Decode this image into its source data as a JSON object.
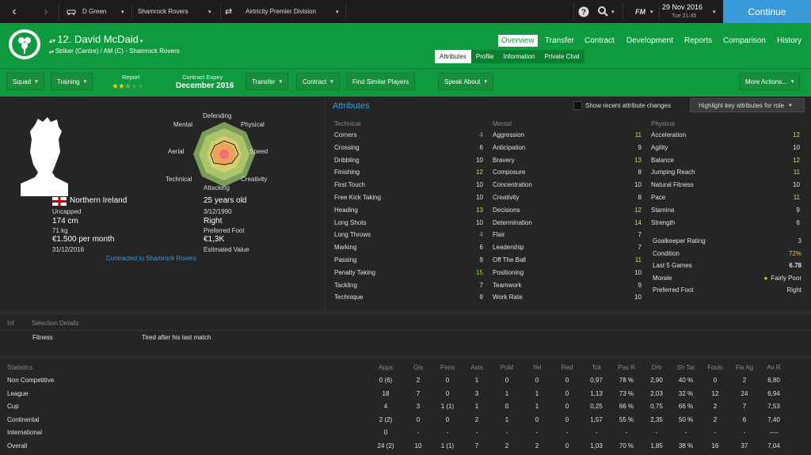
{
  "topbar": {
    "manager": "D Green",
    "club": "Shamrock Rovers",
    "competition": "Airtricity Premier Division",
    "date": "29 Nov 2016",
    "time": "Tue 21:45",
    "fm_label": "FM",
    "continue": "Continue"
  },
  "player": {
    "title": "12. David McDaid",
    "description": "Striker (Centre) / AM (C) - Shamrock Rovers"
  },
  "nav": {
    "tabs": [
      "Overview",
      "Transfer",
      "Contract",
      "Development",
      "Reports",
      "Comparison",
      "History"
    ],
    "active": "Overview"
  },
  "subnav": {
    "tabs": [
      "Attributes",
      "Profile",
      "Information",
      "Private Chat"
    ],
    "active": "Attributes"
  },
  "actions": {
    "squad": "Squad",
    "training": "Training",
    "report_label": "Report",
    "report_stars": 2.5,
    "contract_label": "Contract Expiry",
    "contract_value": "December 2016",
    "transfer": "Transfer",
    "contract": "Contract",
    "similar": "Find Similar Players",
    "speak": "Speak About",
    "more": "More Actions..."
  },
  "radar": {
    "labels": [
      "Defending",
      "Physical",
      "Speed",
      "Creativity",
      "Attacking",
      "Technical",
      "Aerial",
      "Mental"
    ]
  },
  "profile": {
    "nationality": "Northern Ireland",
    "caps": "Uncapped",
    "height": "174 cm",
    "weight": "71 kg",
    "wage": "€1.500 per month",
    "contract_end": "31/12/2016",
    "age": "25 years old",
    "dob": "3/12/1990",
    "foot": "Right",
    "foot_label": "Preferred Foot",
    "value": "€1,3K",
    "value_label": "Estimated Value",
    "contracted": "Contracted to Shamrock Rovers"
  },
  "attributes": {
    "title": "Attributes",
    "show_recent": "Show recent attribute changes",
    "highlight": "Highlight key attributes for role",
    "technical_header": "Technical",
    "mental_header": "Mental",
    "physical_header": "Physical",
    "technical": [
      [
        "Corners",
        "4"
      ],
      [
        "Crossing",
        "6"
      ],
      [
        "Dribbling",
        "10"
      ],
      [
        "Finishing",
        "12"
      ],
      [
        "First Touch",
        "10"
      ],
      [
        "Free Kick Taking",
        "10"
      ],
      [
        "Heading",
        "13"
      ],
      [
        "Long Shots",
        "10"
      ],
      [
        "Long Throws",
        "4"
      ],
      [
        "Marking",
        "6"
      ],
      [
        "Passing",
        "9"
      ],
      [
        "Penalty Taking",
        "15"
      ],
      [
        "Tackling",
        "7"
      ],
      [
        "Technique",
        "9"
      ]
    ],
    "mental": [
      [
        "Aggression",
        "11"
      ],
      [
        "Anticipation",
        "9"
      ],
      [
        "Bravery",
        "13"
      ],
      [
        "Composure",
        "8"
      ],
      [
        "Concentration",
        "10"
      ],
      [
        "Creativity",
        "8"
      ],
      [
        "Decisions",
        "12"
      ],
      [
        "Determination",
        "14"
      ],
      [
        "Flair",
        "7"
      ],
      [
        "Leadership",
        "7"
      ],
      [
        "Off The Ball",
        "11"
      ],
      [
        "Positioning",
        "10"
      ],
      [
        "Teamwork",
        "9"
      ],
      [
        "Work Rate",
        "10"
      ]
    ],
    "physical": [
      [
        "Acceleration",
        "12"
      ],
      [
        "Agility",
        "10"
      ],
      [
        "Balance",
        "12"
      ],
      [
        "Jumping Reach",
        "11"
      ],
      [
        "Natural Fitness",
        "10"
      ],
      [
        "Pace",
        "11"
      ],
      [
        "Stamina",
        "9"
      ],
      [
        "Strength",
        "6"
      ]
    ],
    "extra": [
      [
        "Goalkeeper Rating",
        "3"
      ],
      [
        "Condition",
        "72%"
      ],
      [
        "Last 5 Games",
        "6.78"
      ],
      [
        "Morale",
        "Fairly Poor"
      ],
      [
        "Preferred Foot",
        "Right"
      ]
    ]
  },
  "selection": {
    "col1": "Inf",
    "col2": "Selection Details",
    "row_label": "Fitness",
    "row_value": "Tired after his last match"
  },
  "stats": {
    "headers": [
      "Statistics",
      "Apps",
      "Gls",
      "Pens",
      "Asts",
      "PoM",
      "Yel",
      "Red",
      "Tck",
      "Pas R",
      "Drb",
      "Sh Tar",
      "Fouls",
      "Fls Ag",
      "Av R"
    ],
    "rows": [
      [
        "Non Competitive",
        "0 (6)",
        "2",
        "0",
        "1",
        "0",
        "0",
        "0",
        "0,97",
        "78 %",
        "2,90",
        "40 %",
        "0",
        "2",
        "6,80"
      ],
      [
        "League",
        "18",
        "7",
        "0",
        "3",
        "1",
        "1",
        "0",
        "1,13",
        "73 %",
        "2,03",
        "32 %",
        "12",
        "24",
        "6,94"
      ],
      [
        "Cup",
        "4",
        "3",
        "1 (1)",
        "1",
        "0",
        "1",
        "0",
        "0,25",
        "66 %",
        "0,75",
        "66 %",
        "2",
        "7",
        "7,53"
      ],
      [
        "Continental",
        "2 (2)",
        "0",
        "0",
        "2",
        "1",
        "0",
        "0",
        "1,57",
        "55 %",
        "2,35",
        "50 %",
        "2",
        "6",
        "7,40"
      ],
      [
        "International",
        "0",
        "-",
        "-",
        "-",
        "-",
        "-",
        "-",
        "-",
        "-",
        "-",
        "-",
        "-",
        "-",
        "----"
      ],
      [
        "Overall",
        "24 (2)",
        "10",
        "1 (1)",
        "7",
        "2",
        "2",
        "0",
        "1,03",
        "70 %",
        "1,85",
        "38 %",
        "16",
        "37",
        "7,04"
      ]
    ]
  }
}
